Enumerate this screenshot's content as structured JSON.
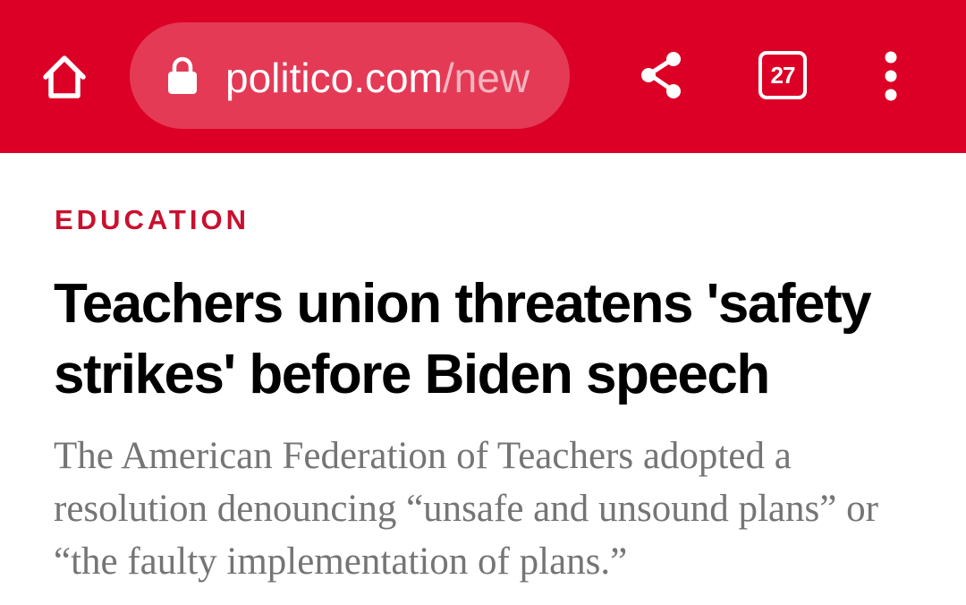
{
  "browser": {
    "toolbar_color": "#dc0026",
    "home_icon": "home-icon",
    "lock_icon": "lock-icon",
    "url_domain": "politico.com",
    "url_path": "/new",
    "share_icon": "share-icon",
    "tab_count": "27",
    "menu_icon": "more-vert-icon"
  },
  "article": {
    "category": "EDUCATION",
    "category_color": "#c8102e",
    "headline": "Teachers union threatens 'safety strikes' before Biden speech",
    "dek": "The American Federation of Teachers adopted a resolution denouncing “unsafe and unsound plans” or “the faulty implementation of plans.”"
  }
}
